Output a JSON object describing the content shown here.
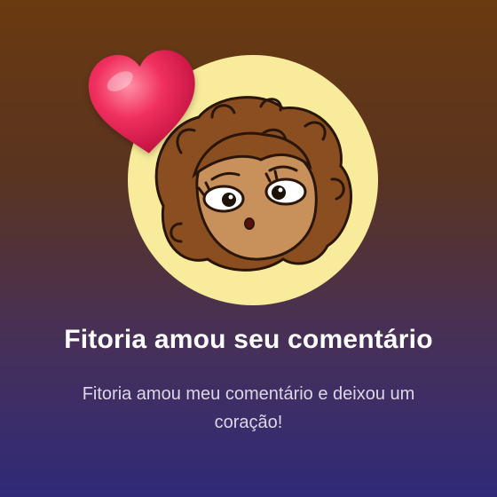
{
  "notification": {
    "title": "Fitoria amou seu comentário",
    "message": "Fitoria amou meu comentário e deixou um coração!"
  },
  "avatar": {
    "icon": "cartoon-girl-avatar"
  },
  "reaction": {
    "icon": "heart-icon",
    "color": "#e8245a"
  },
  "colors": {
    "background_top": "#6a3a10",
    "background_bottom": "#2f2a78",
    "avatar_circle": "#f8ec9c",
    "title_text": "#ffffff",
    "message_text": "#dcd6e6"
  }
}
